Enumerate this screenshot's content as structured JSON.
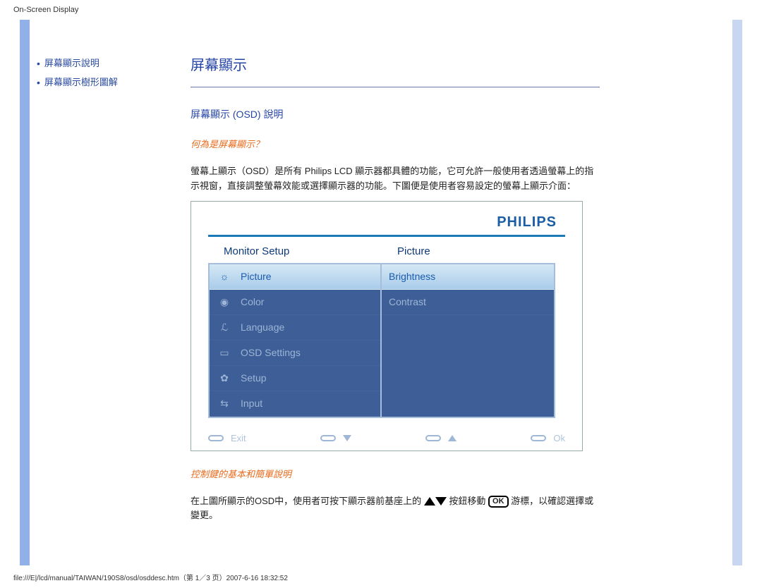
{
  "header": {
    "title": "On-Screen Display"
  },
  "sidebar": {
    "items": [
      {
        "label": "屏幕顯示說明"
      },
      {
        "label": "屏幕顯示樹形圖解"
      }
    ]
  },
  "main": {
    "h1": "屏幕顯示",
    "h2": "屏幕顯示 (OSD) 說明",
    "h3a": "何為是屏幕顯示？",
    "p1": "螢幕上顯示（OSD）是所有 Philips LCD 顯示器都具體的功能，它可允許一般使用者透過螢幕上的指示視窗，直接調整螢幕效能或選擇顯示器的功能。下圖便是使用者容易設定的螢幕上顯示介面：",
    "h3b": "控制鍵的基本和簡單說明",
    "p2_a": "在上圖所顯示的OSD中，使用者可按下顯示器前基座上的 ",
    "p2_b": " 按鈕移動 ",
    "p2_c": " 游標，以確認選擇或變更。",
    "ok_label": "OK"
  },
  "osd": {
    "logo": "PHILIPS",
    "left_title": "Monitor Setup",
    "right_title": "Picture",
    "left_items": [
      {
        "label": "Picture",
        "selected": true,
        "icon": "brightness"
      },
      {
        "label": "Color",
        "selected": false,
        "icon": "globe"
      },
      {
        "label": "Language",
        "selected": false,
        "icon": "lang"
      },
      {
        "label": "OSD Settings",
        "selected": false,
        "icon": "screen"
      },
      {
        "label": "Setup",
        "selected": false,
        "icon": "gear"
      },
      {
        "label": "Input",
        "selected": false,
        "icon": "input"
      }
    ],
    "right_items": [
      {
        "label": "Brightness",
        "selected": true
      },
      {
        "label": "Contrast",
        "selected": false
      }
    ],
    "bottom": {
      "exit": "Exit",
      "ok": "Ok"
    }
  },
  "footer": {
    "text": "file:///E|/lcd/manual/TAIWAN/190S8/osd/osddesc.htm（第 1／3 页）2007-6-16 18:32:52"
  }
}
